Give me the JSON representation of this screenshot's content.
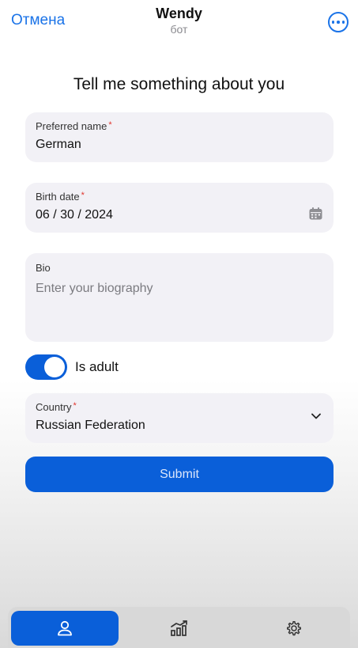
{
  "header": {
    "cancel_label": "Отмена",
    "title": "Wendy",
    "subtitle": "бот",
    "more_icon": "ellipsis-circle-icon"
  },
  "form": {
    "title": "Tell me something about you",
    "preferred_name": {
      "label": "Preferred name",
      "required_mark": "*",
      "value": "German"
    },
    "birth_date": {
      "label": "Birth date",
      "required_mark": "*",
      "value": "06 / 30 / 2024",
      "icon": "calendar-icon"
    },
    "bio": {
      "label": "Bio",
      "placeholder": "Enter your biography",
      "value": ""
    },
    "is_adult": {
      "label": "Is adult",
      "checked": true
    },
    "country": {
      "label": "Country",
      "required_mark": "*",
      "value": "Russian Federation",
      "icon": "chevron-down-icon"
    },
    "submit_label": "Submit"
  },
  "tabbar": {
    "tabs": [
      {
        "icon": "user-icon",
        "active": true
      },
      {
        "icon": "chart-icon",
        "active": false
      },
      {
        "icon": "gear-icon",
        "active": false
      }
    ]
  },
  "colors": {
    "accent": "#0a5fd9",
    "link": "#1a73e8",
    "field_bg": "#f2f1f6",
    "required": "#e0342c"
  }
}
